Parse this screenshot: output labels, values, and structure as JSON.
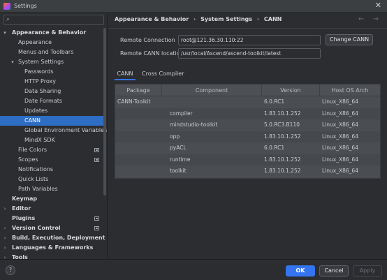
{
  "window": {
    "title": "Settings"
  },
  "sidebar": {
    "search_placeholder": "",
    "items": [
      {
        "label": "Appearance & Behavior",
        "arrow": "▾"
      },
      {
        "label": "Appearance"
      },
      {
        "label": "Menus and Toolbars"
      },
      {
        "label": "System Settings",
        "arrow": "▾"
      },
      {
        "label": "Passwords"
      },
      {
        "label": "HTTP Proxy"
      },
      {
        "label": "Data Sharing"
      },
      {
        "label": "Date Formats"
      },
      {
        "label": "Updates"
      },
      {
        "label": "CANN"
      },
      {
        "label": "Global Environment Variables"
      },
      {
        "label": "MindX SDK"
      },
      {
        "label": "File Colors"
      },
      {
        "label": "Scopes"
      },
      {
        "label": "Notifications"
      },
      {
        "label": "Quick Lists"
      },
      {
        "label": "Path Variables"
      },
      {
        "label": "Keymap"
      },
      {
        "label": "Editor",
        "arrow": "›"
      },
      {
        "label": "Plugins"
      },
      {
        "label": "Version Control",
        "arrow": "›"
      },
      {
        "label": "Build, Execution, Deployment",
        "arrow": "›"
      },
      {
        "label": "Languages & Frameworks",
        "arrow": "›"
      },
      {
        "label": "Tools",
        "arrow": "›"
      }
    ]
  },
  "breadcrumb": {
    "items": [
      "Appearance & Behavior",
      "System Settings",
      "CANN"
    ],
    "separator": "›"
  },
  "nav": {
    "back": "←",
    "forward": "→"
  },
  "form": {
    "remote_connection_label": "Remote Connection",
    "remote_connection_value": "root@121.36.30.110:22",
    "change_button": "Change CANN",
    "remote_location_label": "Remote CANN location",
    "remote_location_value": "/usr/local/Ascend/ascend-toolkit/latest"
  },
  "tabs": [
    "CANN",
    "Cross Compiler"
  ],
  "table": {
    "headers": [
      "Package",
      "Component",
      "Version",
      "Host OS Arch"
    ],
    "rows": [
      [
        "CANN-Toolkit",
        "",
        "6.0.RC1",
        "Linux_X86_64"
      ],
      [
        "",
        "compiler",
        "1.83.10.1.252",
        "Linux_X86_64"
      ],
      [
        "",
        "mindstudio-toolkit",
        "5.0.RC3.B110",
        "Linux_X86_64"
      ],
      [
        "",
        "opp",
        "1.83.10.1.252",
        "Linux_X86_64"
      ],
      [
        "",
        "pyACL",
        "6.0.RC1",
        "Linux_X86_64"
      ],
      [
        "",
        "runtime",
        "1.83.10.1.252",
        "Linux_X86_64"
      ],
      [
        "",
        "toolkit",
        "1.83.10.1.252",
        "Linux_X86_64"
      ]
    ]
  },
  "footer": {
    "help": "?",
    "ok": "OK",
    "cancel": "Cancel",
    "apply": "Apply"
  },
  "colors": {
    "accent": "#3574f0",
    "selection": "#2e6dc4",
    "background": "#2b2d30"
  }
}
